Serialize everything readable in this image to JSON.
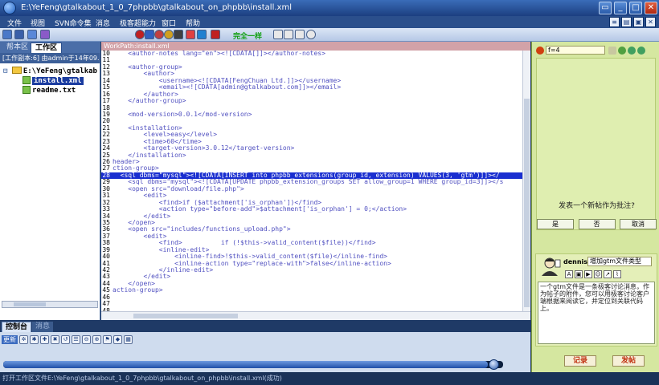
{
  "window": {
    "title": "E:\\YeFeng\\gtalkabout_1_0_7phpbb\\gtalkabout_on_phpbb\\install.xml",
    "controls": [
      "▭",
      "_",
      "□",
      "✕"
    ]
  },
  "menu": {
    "items": [
      "文件",
      "视图",
      "SVN命令集",
      "消息",
      "极客超能力",
      "窗口",
      "帮助"
    ],
    "right_icons": [
      "≡",
      "▤",
      "▣",
      "✕"
    ]
  },
  "toolbar": {
    "status_text": "完全一样",
    "colors": {
      "accent": "#11a011"
    }
  },
  "left_pane": {
    "tabs": [
      "帮本区",
      "工作区"
    ],
    "info": "[工作副本:6] 由admin于14年09...",
    "tree": {
      "root": "E:\\YeFeng\\gtalkab",
      "files": [
        "install.xml",
        "readme.txt"
      ],
      "selected_index": 0
    }
  },
  "editor": {
    "header": "WorkPath:install.xml",
    "highlighted_line": 28,
    "lines": [
      {
        "n": "10",
        "t": "    <author-notes lang=\"en\"><![CDATA[]]></author-notes>"
      },
      {
        "n": "11",
        "t": ""
      },
      {
        "n": "12",
        "t": "    <author-group>"
      },
      {
        "n": "13",
        "t": "        <author>"
      },
      {
        "n": "14",
        "t": "            <username><![CDATA[FengChuan Ltd.]]></username>"
      },
      {
        "n": "15",
        "t": "            <email><![CDATA[admin@gtalkabout.com]]></email>"
      },
      {
        "n": "16",
        "t": "        </author>"
      },
      {
        "n": "17",
        "t": "    </author-group>"
      },
      {
        "n": "18",
        "t": ""
      },
      {
        "n": "19",
        "t": "    <mod-version>0.0.1</mod-version>"
      },
      {
        "n": "20",
        "t": ""
      },
      {
        "n": "21",
        "t": "    <installation>"
      },
      {
        "n": "22",
        "t": "        <level>easy</level>"
      },
      {
        "n": "23",
        "t": "        <time>60</time>"
      },
      {
        "n": "24",
        "t": "        <target-version>3.0.12</target-version>"
      },
      {
        "n": "25",
        "t": "    </installation>"
      },
      {
        "n": "26",
        "t": "header>"
      },
      {
        "n": "27",
        "t": "ction-group>"
      },
      {
        "n": "28",
        "t": "  <sql dbms=\"mysql\"><![CDATA[INSERT into phpbb_extensions(group_id, extension) VALUES(3, 'gtm')]]></"
      },
      {
        "n": "29",
        "t": "    <sql dbms=\"mysql\"><![CDATA[UPDATE phpbb_extension_groups SET allow_group=1 WHERE group_id=3]]></s"
      },
      {
        "n": "30",
        "t": "    <open src=\"download/file.php\">"
      },
      {
        "n": "31",
        "t": "        <edit>"
      },
      {
        "n": "32",
        "t": "            <find>if ($attachment['is_orphan'])</find>"
      },
      {
        "n": "33",
        "t": "            <action type=\"before-add\">$attachment['is_orphan'] = 0;</action>"
      },
      {
        "n": "34",
        "t": "        </edit>"
      },
      {
        "n": "35",
        "t": "    </open>"
      },
      {
        "n": "36",
        "t": "    <open src=\"includes/functions_upload.php\">"
      },
      {
        "n": "37",
        "t": "        <edit>"
      },
      {
        "n": "38",
        "t": "            <find>          if (!$this->valid_content($file))</find>"
      },
      {
        "n": "39",
        "t": "            <inline-edit>"
      },
      {
        "n": "40",
        "t": "                <inline-find>!$this->valid_content($file)</inline-find>"
      },
      {
        "n": "41",
        "t": "                <inline-action type=\"replace-with\">false</inline-action>"
      },
      {
        "n": "42",
        "t": "            </inline-edit>"
      },
      {
        "n": "43",
        "t": "        </edit>"
      },
      {
        "n": "44",
        "t": "    </open>"
      },
      {
        "n": "45",
        "t": "action-group>"
      },
      {
        "n": "46",
        "t": ""
      },
      {
        "n": "47",
        "t": ""
      },
      {
        "n": "48",
        "t": ""
      }
    ]
  },
  "right_pane": {
    "search_value": "f=4",
    "question": "发表一个新帖作为批注?",
    "buttons": {
      "yes": "是",
      "no": "否",
      "cancel": "取消"
    },
    "compose": {
      "username": "dennis",
      "topic": "增加gtm文件类型",
      "body": "一个gtm文件是一条极客讨论消息，作为帖子的附件，您可以用极客讨论客户端根据来阅读它，并定位到关联代码上。"
    },
    "actions": {
      "record": "记录",
      "post": "发帖"
    }
  },
  "console": {
    "tabs": [
      "控制台",
      "消息"
    ],
    "update_label": "更新",
    "progress": 0.97
  },
  "status": {
    "text": "打开工作区文件E:\\YeFeng\\gtalkabout_1_0_7phpbb\\gtalkabout_on_phpbb\\install.xml(成功)"
  }
}
